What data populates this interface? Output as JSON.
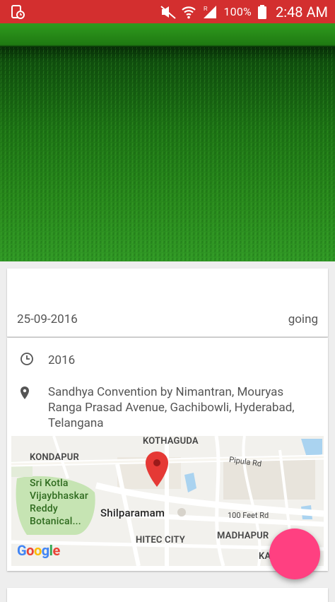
{
  "status_bar": {
    "battery_text": "100%",
    "time": "2:48 AM",
    "icons": [
      "screen-timer-icon",
      "mute-icon",
      "wifi-icon",
      "signal-icon",
      "battery-icon"
    ],
    "background": "#d32f2f"
  },
  "event": {
    "date": "25-09-2016",
    "status": "going",
    "time_label": "2016",
    "location": "Sandhya Convention by Nimantran, Mouryas Ranga Prasad Avenue, Gachibowli, Hyderabad, Telangana"
  },
  "map": {
    "labels": {
      "kothaguda": "KOTHAGUDA",
      "kondapur": "KONDAPUR",
      "pipula_rd": "Pipula Rd",
      "botanical": "Sri Kotla Vijaybhaskar Reddy Botanical...",
      "shilparamam": "Shilparamam",
      "feet_rd": "100 Feet Rd",
      "hitec_city": "HITEC CITY",
      "madhapur": "MADHAPUR",
      "partial": "KA"
    },
    "logo": "Google"
  },
  "fab": {
    "color": "#ff4081"
  }
}
